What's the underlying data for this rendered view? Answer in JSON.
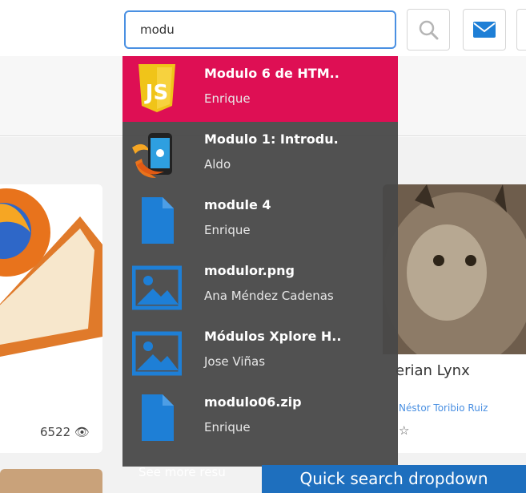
{
  "header": {
    "search_value": "modu"
  },
  "dropdown": {
    "items": [
      {
        "title": "Modulo 6 de HTM..",
        "author": "Enrique",
        "icon": "javascript-logo-icon",
        "active": true
      },
      {
        "title": "Modulo 1: Introdu.",
        "author": "Aldo",
        "icon": "firefox-phone-icon",
        "active": false
      },
      {
        "title": "module 4",
        "author": "Enrique",
        "icon": "document-icon",
        "active": false
      },
      {
        "title": "modulor.png",
        "author": "Ana Méndez Cadenas",
        "icon": "image-icon",
        "active": false
      },
      {
        "title": "Módulos Xplore H..",
        "author": "Jose Viñas",
        "icon": "image-icon",
        "active": false
      },
      {
        "title": "modulo06.zip",
        "author": "Enrique",
        "icon": "document-icon",
        "active": false
      }
    ],
    "see_more": "See more resu"
  },
  "background": {
    "left_card_views": "6522",
    "right_card_title": "erian Lynx",
    "right_card_author": "Néstor Toribio Ruiz"
  },
  "caption": "Quick search dropdown",
  "colors": {
    "accent": "#4a90e2",
    "active_item": "#de0f54",
    "dropdown_bg": "#484848",
    "file_icon": "#1e7fd6",
    "caption_bg": "#1e6fbe"
  }
}
